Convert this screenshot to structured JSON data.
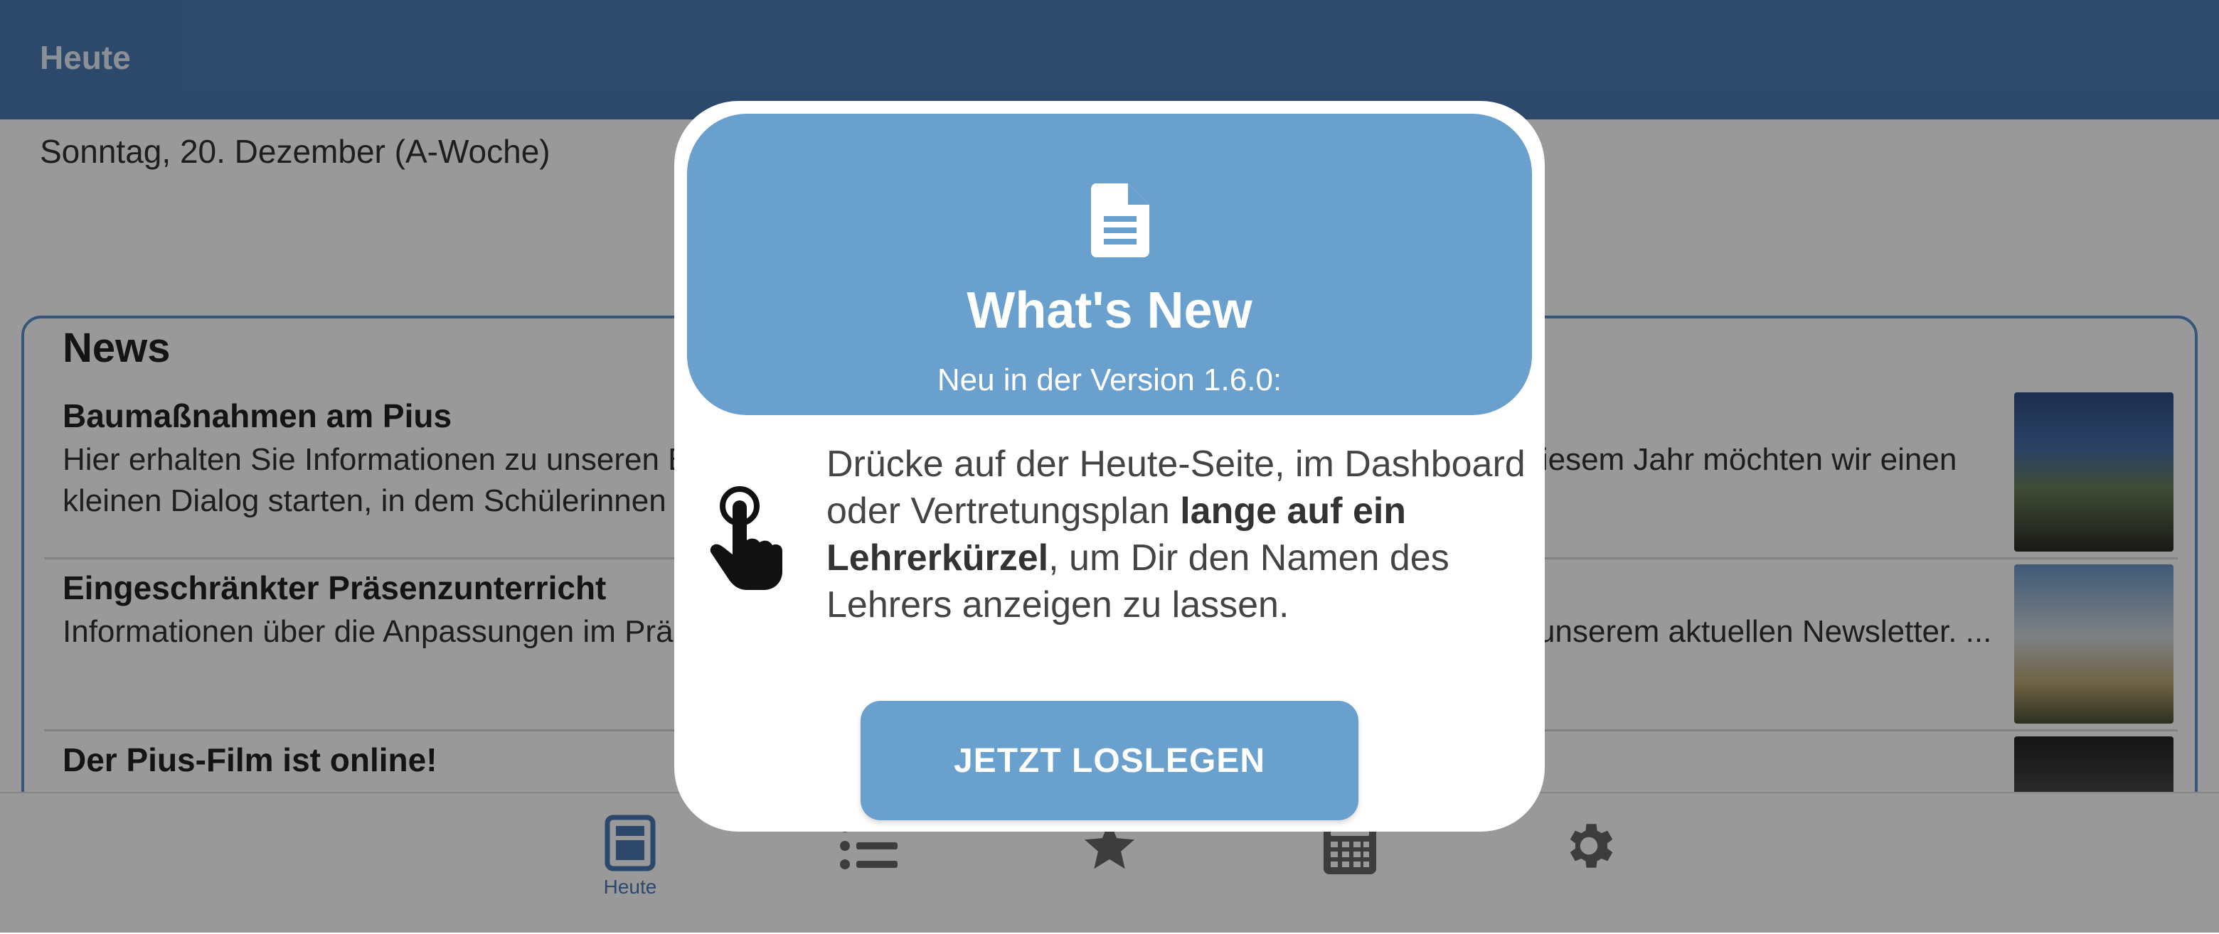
{
  "header": {
    "title": "Heute"
  },
  "date_line": "Sonntag, 20. Dezember (A-Woche)",
  "news": {
    "heading": "News",
    "items": [
      {
        "title": "Baumaßnahmen am Pius",
        "text": "Hier erhalten Sie Informationen zu unseren Baumaßnahmen. Mit einem Film über die Baumaßnahmen in diesem Jahr möchten wir einen kleinen Dialog starten, in dem Schülerinnen und Schüler der Klasse 9c ..."
      },
      {
        "title": "Eingeschränkter Präsenzunterricht",
        "text": "Informationen über die Anpassungen im Präsenzunterricht und zum Distanzunterricht entnehmen Sie bitte unserem aktuellen Newsletter. ..."
      },
      {
        "title": "Der Pius-Film ist online!",
        "text": ""
      }
    ]
  },
  "bottom_nav": {
    "items": [
      {
        "label": "Heute",
        "icon": "today-icon",
        "active": true
      },
      {
        "label": "",
        "icon": "list-icon"
      },
      {
        "label": "",
        "icon": "star-icon"
      },
      {
        "label": "",
        "icon": "calculator-icon"
      },
      {
        "label": "",
        "icon": "gear-icon"
      }
    ]
  },
  "dialog": {
    "icon": "document-icon",
    "title": "What's New",
    "subtitle": "Neu in der Version 1.6.0:",
    "body_icon": "touch-hand-icon",
    "body_part1": "Drücke auf der Heute-Seite, im Dashboard oder Vertretungsplan ",
    "body_bold": "lange auf ein Lehrerkürzel",
    "body_part2": ", um Dir den Namen des Lehrers anzeigen zu lassen.",
    "button_label": "JETZT LOSLEGEN"
  },
  "colors": {
    "header_bg": "#4a7bb3",
    "dialog_accent": "#6aa0ce",
    "overlay": "rgba(0,0,0,0.40)"
  }
}
